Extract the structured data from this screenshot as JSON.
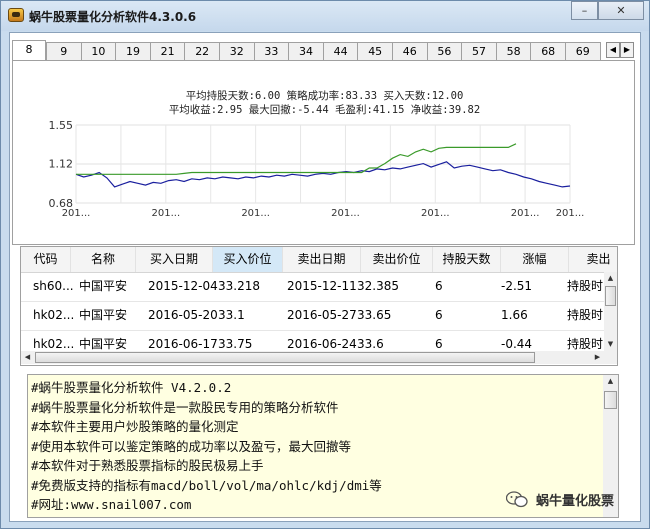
{
  "window": {
    "title": "蜗牛股票量化分析软件4.3.0.6",
    "minimize_label": "–",
    "close_label": "✕"
  },
  "tabs": [
    "8",
    "9",
    "10",
    "19",
    "21",
    "22",
    "32",
    "33",
    "34",
    "44",
    "45",
    "46",
    "56",
    "57",
    "58",
    "68",
    "69"
  ],
  "active_tab": "8",
  "stats": {
    "line1": "平均持股天数:6.00 策略成功率:83.33 买入天数:12.00",
    "line2": "平均收益:2.95 最大回撤:-5.44 毛盈利:41.15 净收益:39.82"
  },
  "chart_data": {
    "type": "line",
    "title": "",
    "y_ticks": [
      "1.55",
      "1.12",
      "0.68"
    ],
    "ylim": [
      0.68,
      1.55
    ],
    "x_ticks": [
      "201...",
      "201...",
      "201...",
      "201...",
      "201...",
      "201...",
      "201...",
      "201...",
      "201...",
      "201...",
      "201...",
      "201..."
    ],
    "series": [
      {
        "name": "",
        "color": "#1a1f9e",
        "values": [
          1.0,
          0.97,
          0.99,
          1.02,
          0.96,
          0.86,
          0.89,
          0.92,
          0.9,
          0.88,
          0.91,
          0.9,
          0.93,
          0.94,
          0.92,
          0.95,
          0.94,
          0.96,
          0.95,
          0.97,
          0.96,
          0.95,
          0.97,
          0.96,
          0.98,
          0.97,
          0.99,
          0.98,
          1.0,
          0.99,
          0.98,
          1.0,
          1.01,
          1.0,
          1.02,
          1.03,
          1.02,
          1.04,
          1.03,
          1.06,
          1.05,
          1.07,
          1.06,
          1.08,
          1.1,
          1.12,
          1.08,
          1.11,
          1.14,
          1.07,
          1.09,
          1.1,
          1.08,
          1.06,
          1.04,
          1.05,
          1.02,
          1.0,
          0.97,
          0.95,
          0.92,
          0.9,
          0.88,
          0.86,
          0.87
        ]
      },
      {
        "name": "",
        "color": "#3a9a2a",
        "values": [
          1.0,
          1.0,
          1.0,
          1.0,
          1.0,
          1.0,
          1.0,
          1.0,
          1.0,
          1.0,
          1.0,
          1.0,
          1.0,
          1.0,
          1.01,
          1.02,
          1.02,
          1.02,
          1.02,
          1.02,
          1.02,
          1.02,
          1.02,
          1.02,
          1.02,
          1.02,
          1.02,
          1.02,
          1.02,
          1.02,
          1.02,
          1.02,
          1.02,
          1.02,
          1.02,
          1.02,
          1.02,
          1.02,
          1.07,
          1.07,
          1.12,
          1.18,
          1.22,
          1.2,
          1.25,
          1.28,
          1.25,
          1.29,
          1.3,
          1.3,
          1.3,
          1.3,
          1.3,
          1.3,
          1.3,
          1.3,
          1.3,
          1.34,
          null,
          null,
          null,
          null,
          null,
          null,
          null
        ]
      }
    ]
  },
  "trades_table": {
    "columns": [
      "代码",
      "名称",
      "买入日期",
      "买入价位",
      "卖出日期",
      "卖出价位",
      "持股天数",
      "涨幅",
      "卖出"
    ],
    "selected_column": "买入价位",
    "rows": [
      [
        "sh60...",
        "中国平安",
        "2015-12-04",
        "33.218",
        "2015-12-11",
        "32.385",
        "6",
        "-2.51",
        "持股时间"
      ],
      [
        "hk02...",
        "中国平安",
        "2016-05-20",
        "33.1",
        "2016-05-27",
        "33.65",
        "6",
        "1.66",
        "持股时间"
      ],
      [
        "hk02...",
        "中国平安",
        "2016-06-17",
        "33.75",
        "2016-06-24",
        "33.6",
        "6",
        "-0.44",
        "持股时间"
      ]
    ]
  },
  "log_lines": [
    "#蜗牛股票量化分析软件 V4.2.0.2",
    "#蜗牛股票量化分析软件是一款股民专用的策略分析软件",
    "#本软件主要用户炒股策略的量化测定",
    "#使用本软件可以鉴定策略的成功率以及盈亏，最大回撤等",
    "#本软件对于熟悉股票指标的股民极易上手",
    "#免费版支持的指标有macd/boll/vol/ma/ohlc/kdj/dmi等",
    "#网址:www.snail007.com"
  ],
  "watermark": "蜗牛量化股票"
}
